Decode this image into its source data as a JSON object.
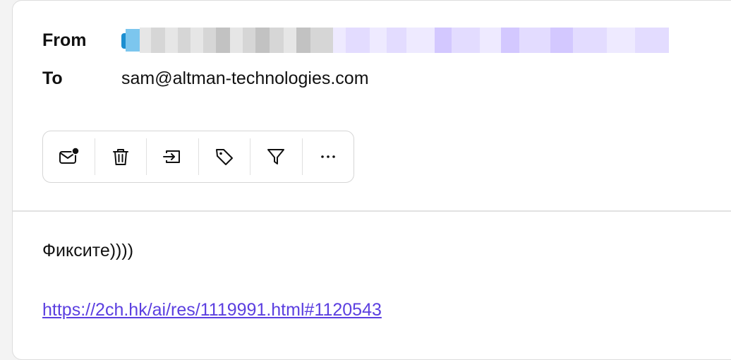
{
  "header": {
    "from_label": "From",
    "to_label": "To",
    "to_value": "sam@altman-technologies.com"
  },
  "toolbar": {
    "buttons": [
      {
        "name": "mark-unread",
        "icon": "mail-unread-icon"
      },
      {
        "name": "delete",
        "icon": "trash-icon"
      },
      {
        "name": "move",
        "icon": "move-to-folder-icon"
      },
      {
        "name": "tag",
        "icon": "tag-icon"
      },
      {
        "name": "filter",
        "icon": "filter-icon"
      },
      {
        "name": "more",
        "icon": "more-icon"
      }
    ]
  },
  "message": {
    "body_text": "Фиксите))))",
    "link_text": "https://2ch.hk/ai/res/1119991.html#1120543"
  },
  "colors": {
    "link": "#5b3fe0",
    "border": "#d6d6d6"
  }
}
